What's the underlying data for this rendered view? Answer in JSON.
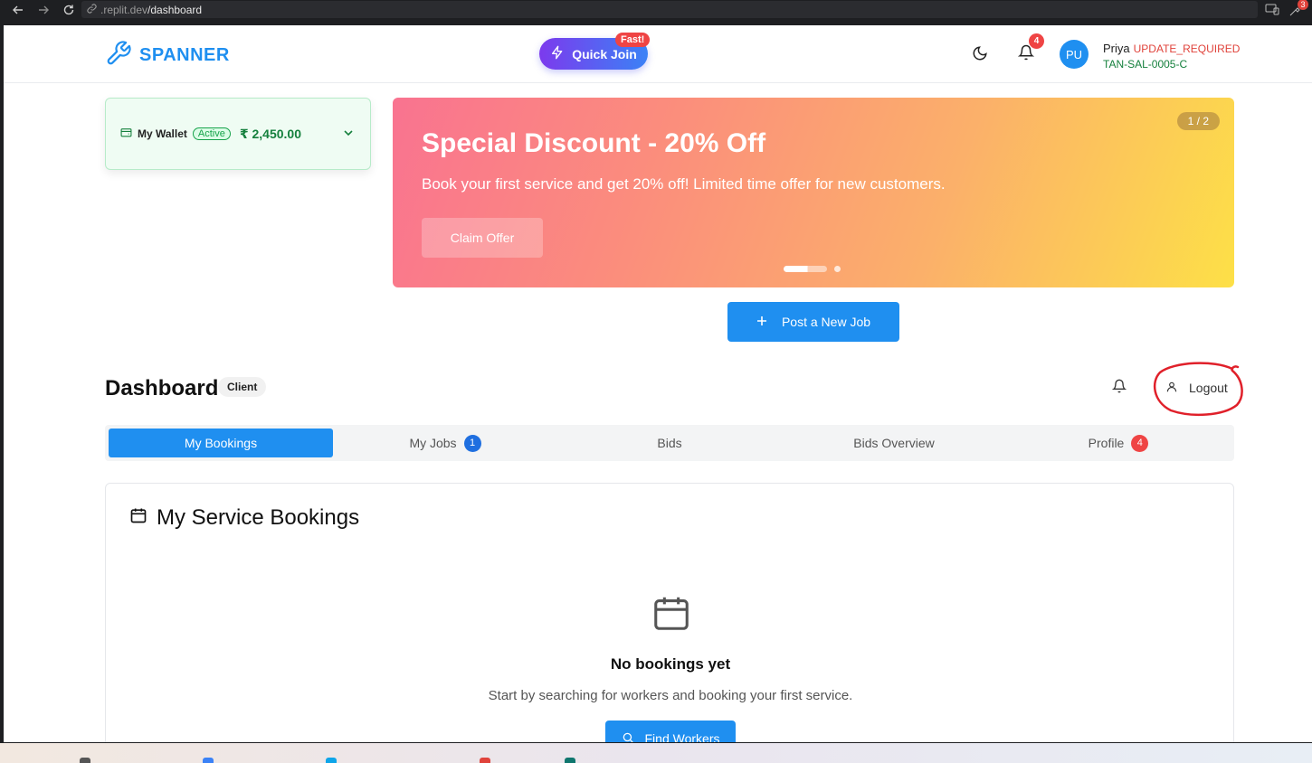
{
  "browser": {
    "url_host": ".replit.dev",
    "url_path": "/dashboard",
    "extension_badge": "3"
  },
  "header": {
    "brand": "SPANNER",
    "quick_join_label": "Quick Join",
    "fast_badge": "Fast!",
    "notification_count": "4",
    "avatar_initials": "PU",
    "user_name": "Priya",
    "user_status": "UPDATE_REQUIRED",
    "user_id": "TAN-SAL-0005-C"
  },
  "wallet": {
    "label": "My Wallet",
    "status": "Active",
    "amount": "₹ 2,450.00"
  },
  "banner": {
    "counter": "1 / 2",
    "title": "Special Discount - 20% Off",
    "subtitle": "Book your first service and get 20% off! Limited time offer for new customers.",
    "cta": "Claim Offer"
  },
  "post_job_label": "Post a New Job",
  "dashboard": {
    "title": "Dashboard",
    "role_chip": "Client",
    "logout_label": "Logout"
  },
  "tabs": [
    {
      "label": "My Bookings",
      "badge": ""
    },
    {
      "label": "My Jobs",
      "badge": "1"
    },
    {
      "label": "Bids",
      "badge": ""
    },
    {
      "label": "Bids Overview",
      "badge": ""
    },
    {
      "label": "Profile",
      "badge": "4"
    }
  ],
  "bookings": {
    "title": "My Service Bookings",
    "empty_title": "No bookings yet",
    "empty_subtitle": "Start by searching for workers and booking your first service.",
    "find_workers_label": "Find Workers"
  },
  "colors": {
    "primary": "#1f8ff0",
    "success": "#15803d",
    "danger": "#ef4444"
  }
}
